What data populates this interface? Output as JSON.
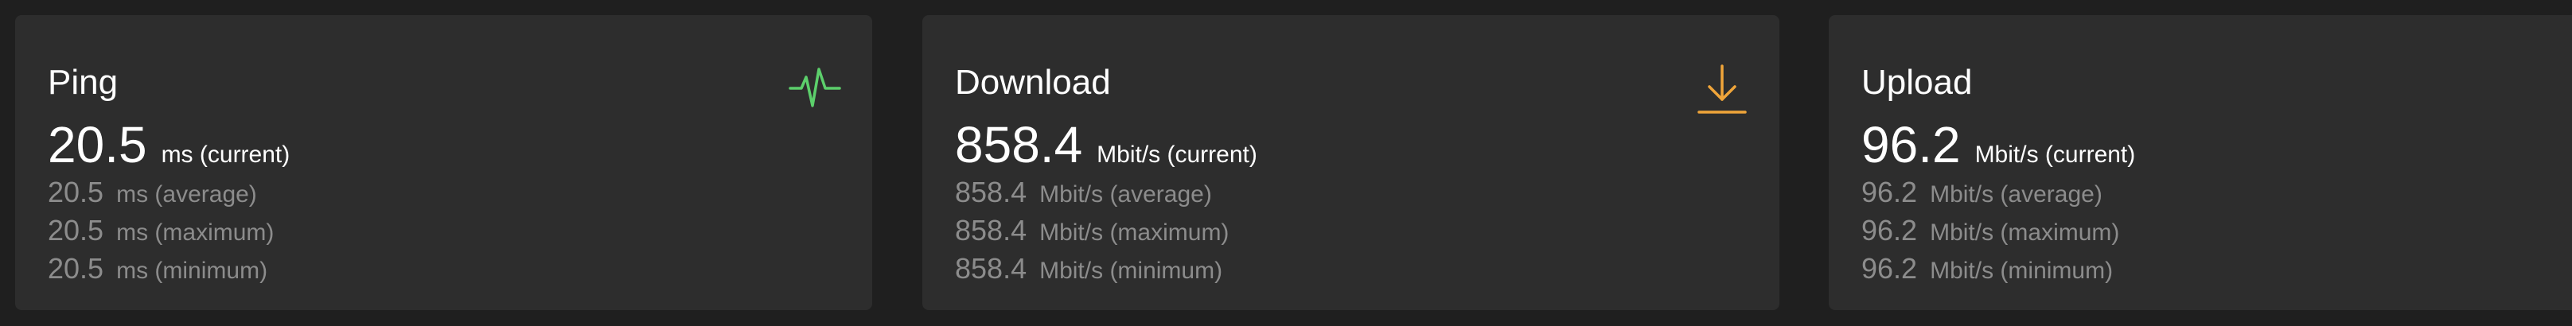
{
  "colors": {
    "background": "#1f1f1f",
    "card": "#2d2d2d",
    "ping_accent": "#5ccf6b",
    "download_accent": "#f0a53a",
    "muted_text": "#8c8c8c"
  },
  "cards": {
    "ping": {
      "title": "Ping",
      "icon": "activity-icon",
      "current_value": "20.5",
      "current_unit": "ms (current)",
      "average_value": "20.5",
      "average_unit": "ms (average)",
      "maximum_value": "20.5",
      "maximum_unit": "ms (maximum)",
      "minimum_value": "20.5",
      "minimum_unit": "ms (minimum)"
    },
    "download": {
      "title": "Download",
      "icon": "download-icon",
      "current_value": "858.4",
      "current_unit": "Mbit/s (current)",
      "average_value": "858.4",
      "average_unit": "Mbit/s (average)",
      "maximum_value": "858.4",
      "maximum_unit": "Mbit/s (maximum)",
      "minimum_value": "858.4",
      "minimum_unit": "Mbit/s (minimum)"
    },
    "upload": {
      "title": "Upload",
      "current_value": "96.2",
      "current_unit": "Mbit/s (current)",
      "average_value": "96.2",
      "average_unit": "Mbit/s (average)",
      "maximum_value": "96.2",
      "maximum_unit": "Mbit/s (maximum)",
      "minimum_value": "96.2",
      "minimum_unit": "Mbit/s (minimum)"
    }
  }
}
